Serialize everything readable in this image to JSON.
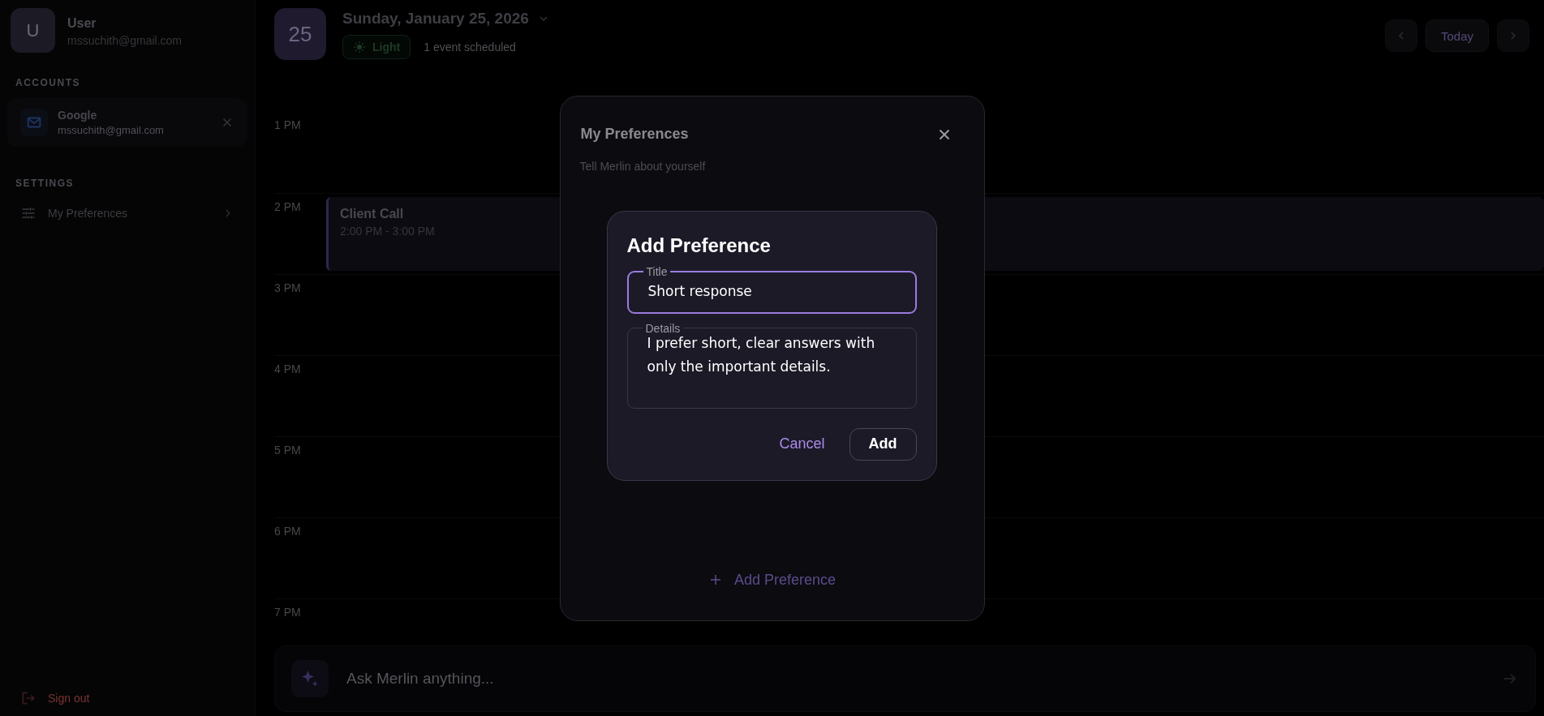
{
  "user": {
    "initial": "U",
    "name": "User",
    "email": "mssuchith@gmail.com"
  },
  "sidebar": {
    "accounts_heading": "ACCOUNTS",
    "accounts": [
      {
        "name": "Google",
        "email": "mssuchith@gmail.com"
      }
    ],
    "settings_heading": "SETTINGS",
    "settings_items": [
      {
        "label": "My Preferences"
      }
    ],
    "sign_out": "Sign out"
  },
  "header": {
    "day": "25",
    "date": "Sunday, January 25, 2026",
    "theme_label": "Light",
    "event_count": "1 event scheduled",
    "today": "Today"
  },
  "calendar": {
    "hours": [
      {
        "label": "1 PM"
      },
      {
        "label": "2 PM",
        "events": [
          {
            "title": "Client Call",
            "time": "2:00 PM - 3:00 PM"
          }
        ]
      },
      {
        "label": "3 PM"
      },
      {
        "label": "4 PM"
      },
      {
        "label": "5 PM"
      },
      {
        "label": "6 PM"
      },
      {
        "label": "7 PM"
      }
    ]
  },
  "ask_bar": {
    "placeholder": "Ask Merlin anything..."
  },
  "preferences_dialog": {
    "title": "My Preferences",
    "subtitle": "Tell Merlin about yourself",
    "add_button": "Add Preference"
  },
  "add_dialog": {
    "title": "Add Preference",
    "fields": [
      {
        "kind": "input",
        "label": "Title",
        "value": "Short response",
        "focused": true
      },
      {
        "kind": "textarea",
        "label": "Details",
        "value": "I prefer short, clear answers with only the important details.",
        "focused": false
      }
    ],
    "cancel": "Cancel",
    "add": "Add"
  }
}
